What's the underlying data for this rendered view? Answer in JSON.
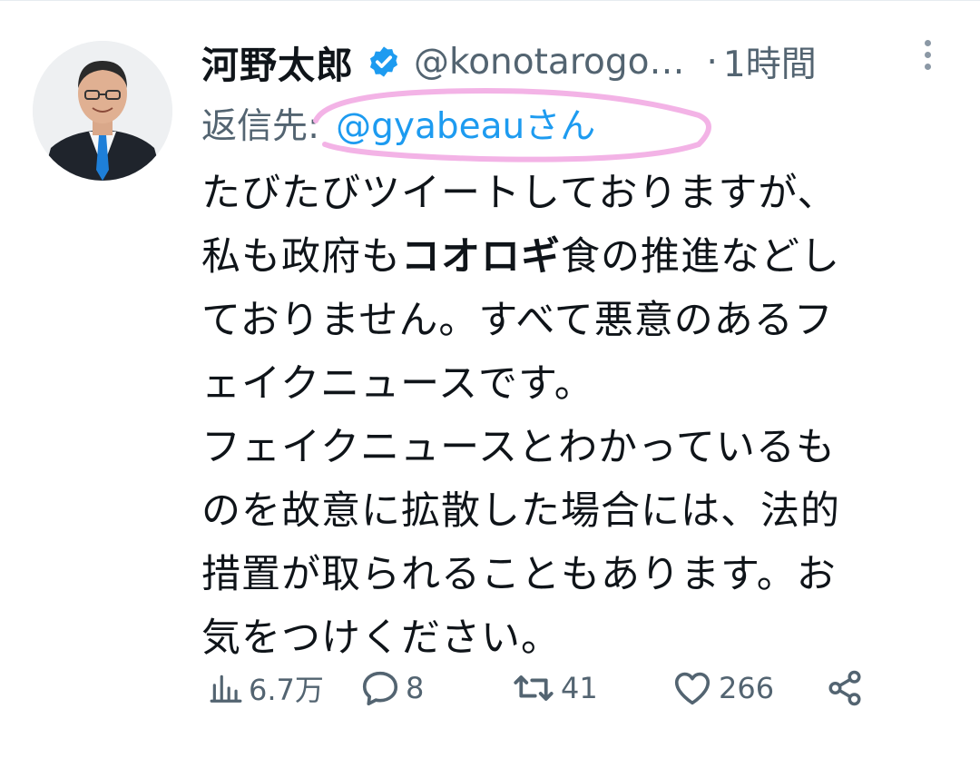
{
  "tweet": {
    "author_name": "河野太郎",
    "author_handle": "@konotarogo…",
    "separator_dot": "·",
    "time_ago": "1時間",
    "reply_to_label": "返信先:",
    "reply_to_mention": "@gyabeauさん",
    "body_lines": [
      {
        "pre": "たびたびツイートしておりますが、",
        "bold": "",
        "post": ""
      },
      {
        "pre": "私も政府も",
        "bold": "コオロギ",
        "post": "食の推進などし"
      },
      {
        "pre": "ておりません。すべて悪意のあるフ",
        "bold": "",
        "post": ""
      },
      {
        "pre": "ェイクニュースです。",
        "bold": "",
        "post": ""
      },
      {
        "pre": "フェイクニュースとわかっているも",
        "bold": "",
        "post": ""
      },
      {
        "pre": "のを故意に拡散した場合には、法的",
        "bold": "",
        "post": ""
      },
      {
        "pre": "措置が取られることもあります。お",
        "bold": "",
        "post": ""
      },
      {
        "pre": "気をつけください。",
        "bold": "",
        "post": ""
      }
    ]
  },
  "actions": {
    "views": "6.7万",
    "replies": "8",
    "retweets": "41",
    "likes": "266"
  },
  "icons": [
    "verified-badge-icon",
    "more-icon",
    "views-icon",
    "reply-icon",
    "retweet-icon",
    "like-icon",
    "share-icon"
  ],
  "colors": {
    "text": "#0f1419",
    "secondary": "#536471",
    "link": "#1d9bf0",
    "highlight_annotation": "#f3b3e6"
  }
}
